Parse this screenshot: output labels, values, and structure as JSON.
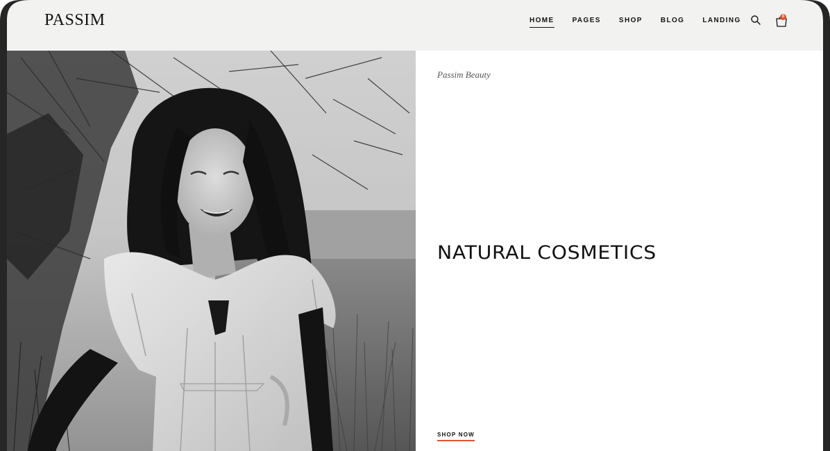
{
  "header": {
    "logo": "PASSIM",
    "nav": [
      {
        "label": "HOME",
        "active": true
      },
      {
        "label": "PAGES",
        "active": false
      },
      {
        "label": "SHOP",
        "active": false
      },
      {
        "label": "BLOG",
        "active": false
      },
      {
        "label": "LANDING",
        "active": false
      }
    ],
    "search_icon": "search-icon",
    "cart_icon": "shopping-bag-icon",
    "cart_count": "0"
  },
  "hero": {
    "eyebrow": "Passim Beauty",
    "headline": "NATURAL COSMETICS",
    "cta": "SHOP NOW",
    "image": "black-and-white photo of smiling woman with long dark hair in white dress among grass and branches"
  },
  "colors": {
    "header_bg": "#f2f2f0",
    "accent": "#e2542e",
    "text": "#111111",
    "frame": "#262626"
  }
}
